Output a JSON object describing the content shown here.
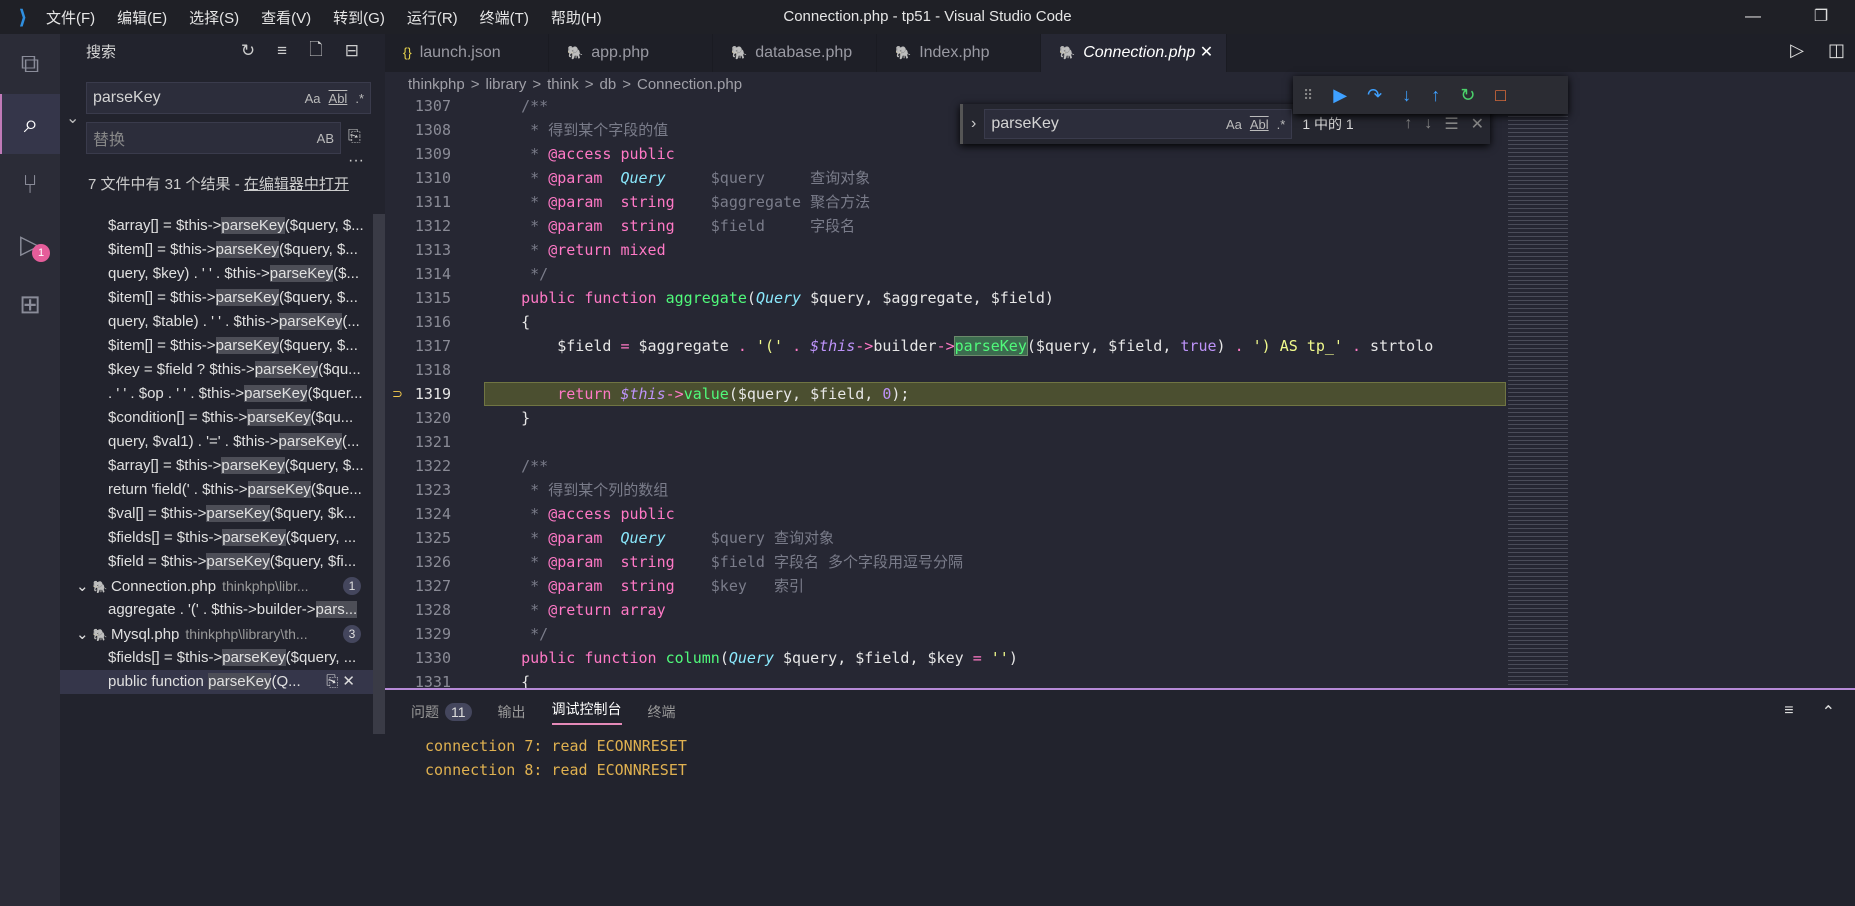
{
  "window": {
    "title": "Connection.php - tp51 - Visual Studio Code",
    "menu": [
      "文件(F)",
      "编辑(E)",
      "选择(S)",
      "查看(V)",
      "转到(G)",
      "运行(R)",
      "终端(T)",
      "帮助(H)"
    ]
  },
  "activity": {
    "debug_badge": "1"
  },
  "sidebar": {
    "title": "搜索",
    "search_value": "parseKey",
    "replace_placeholder": "替换",
    "opt_case": "Aa",
    "opt_word": "Abl",
    "opt_regex": ".*",
    "opt_preserve": "AB",
    "summary": "7 文件中有 31 个结果 - ",
    "open_in_editor": "在编辑器中打开",
    "results": [
      {
        "pre": "$array[] = $this->",
        "hl": "parseKey",
        "post": "($query, $..."
      },
      {
        "pre": "$item[] = $this->",
        "hl": "parseKey",
        "post": "($query, $..."
      },
      {
        "pre": "query, $key) . ' ' . $this->",
        "hl": "parseKey",
        "post": "($..."
      },
      {
        "pre": "$item[] = $this->",
        "hl": "parseKey",
        "post": "($query, $..."
      },
      {
        "pre": "query, $table) . ' ' . $this->",
        "hl": "parseKey",
        "post": "(..."
      },
      {
        "pre": "$item[] = $this->",
        "hl": "parseKey",
        "post": "($query, $..."
      },
      {
        "pre": "$key = $field ? $this->",
        "hl": "parseKey",
        "post": "($qu..."
      },
      {
        "pre": ". ' ' . $op . ' ' . $this->",
        "hl": "parseKey",
        "post": "($quer..."
      },
      {
        "pre": "$condition[] = $this->",
        "hl": "parseKey",
        "post": "($qu..."
      },
      {
        "pre": "query, $val1) . '=' . $this->",
        "hl": "parseKey",
        "post": "(..."
      },
      {
        "pre": "$array[] = $this->",
        "hl": "parseKey",
        "post": "($query, $..."
      },
      {
        "pre": "return 'field(' . $this->",
        "hl": "parseKey",
        "post": "($que..."
      },
      {
        "pre": "$val[] = $this->",
        "hl": "parseKey",
        "post": "($query, $k..."
      },
      {
        "pre": "$fields[] = $this->",
        "hl": "parseKey",
        "post": "($query, ..."
      },
      {
        "pre": "$field = $this->",
        "hl": "parseKey",
        "post": "($query, $fi..."
      },
      {
        "file": "Connection.php",
        "path": "thinkphp\\libr...",
        "count": "1"
      },
      {
        "pre": "aggregate . '(' . $this->builder->",
        "hl": "pars...",
        "post": ""
      },
      {
        "file": "Mysql.php",
        "path": "thinkphp\\library\\th...",
        "count": "3"
      },
      {
        "pre": "$fields[] = $this->",
        "hl": "parseKey",
        "post": "($query, ..."
      },
      {
        "pre": "public function ",
        "hl": "parseKey",
        "post": "(Q...",
        "selected": true
      }
    ]
  },
  "tabs": [
    {
      "label": "launch.json",
      "icon": "{}"
    },
    {
      "label": "app.php",
      "icon": "php"
    },
    {
      "label": "database.php",
      "icon": "php"
    },
    {
      "label": "Index.php",
      "icon": "php"
    },
    {
      "label": "Connection.php",
      "icon": "php",
      "active": true
    }
  ],
  "breadcrumb": [
    "thinkphp",
    ">",
    "library",
    ">",
    "think",
    ">",
    "db",
    ">",
    "Connection.php"
  ],
  "find": {
    "value": "parseKey",
    "opt_case": "Aa",
    "opt_word": "Abl",
    "opt_regex": ".*",
    "count": "1 中的 1"
  },
  "code": {
    "first_line": 1307,
    "current_line": 1319,
    "lines": [
      [
        [
          "    /**",
          "c"
        ]
      ],
      [
        [
          "     * 得到某个字段的值",
          "c"
        ]
      ],
      [
        [
          "     * ",
          "c"
        ],
        [
          "@access",
          "cd"
        ],
        [
          " public",
          "cp"
        ]
      ],
      [
        [
          "     * ",
          "c"
        ],
        [
          "@param",
          "cd"
        ],
        [
          "  ",
          "c"
        ],
        [
          "Query",
          "ty"
        ],
        [
          "     $query     查询对象",
          "c"
        ]
      ],
      [
        [
          "     * ",
          "c"
        ],
        [
          "@param",
          "cd"
        ],
        [
          "  string",
          "cp"
        ],
        [
          "    $aggregate 聚合方法",
          "c"
        ]
      ],
      [
        [
          "     * ",
          "c"
        ],
        [
          "@param",
          "cd"
        ],
        [
          "  string",
          "cp"
        ],
        [
          "    $field     字段名",
          "c"
        ]
      ],
      [
        [
          "     * ",
          "c"
        ],
        [
          "@return",
          "cd"
        ],
        [
          " mixed",
          "cp"
        ]
      ],
      [
        [
          "     */",
          "c"
        ]
      ],
      [
        [
          "    ",
          "m"
        ],
        [
          "public function",
          "k"
        ],
        [
          " ",
          "m"
        ],
        [
          "aggregate",
          "fn"
        ],
        [
          "(",
          "m"
        ],
        [
          "Query",
          "ty"
        ],
        [
          " $query, $aggregate, $field)",
          "m"
        ]
      ],
      [
        [
          "    {",
          "m"
        ]
      ],
      [
        [
          "        $field ",
          "m"
        ],
        [
          "=",
          "op"
        ],
        [
          " $aggregate ",
          "m"
        ],
        [
          ".",
          "op"
        ],
        [
          " ",
          "m"
        ],
        [
          "'('",
          "s"
        ],
        [
          " ",
          "m"
        ],
        [
          ".",
          "op"
        ],
        [
          " ",
          "m"
        ],
        [
          "$this",
          "th"
        ],
        [
          "->",
          "op"
        ],
        [
          "builder",
          "m"
        ],
        [
          "->",
          "op"
        ],
        [
          "parseKey",
          "match"
        ],
        [
          "($query, $field, ",
          "m"
        ],
        [
          "true",
          "n"
        ],
        [
          ") ",
          "m"
        ],
        [
          ".",
          "op"
        ],
        [
          " ",
          "m"
        ],
        [
          "') AS tp_'",
          "s"
        ],
        [
          " ",
          "m"
        ],
        [
          ".",
          "op"
        ],
        [
          " strtolo",
          "m"
        ]
      ],
      [
        [
          "",
          "m"
        ]
      ],
      [
        [
          "        ",
          "m"
        ],
        [
          "return",
          "k"
        ],
        [
          " ",
          "m"
        ],
        [
          "$this",
          "th"
        ],
        [
          "->",
          "op"
        ],
        [
          "value",
          "fn"
        ],
        [
          "($query, $field, ",
          "m"
        ],
        [
          "0",
          "n"
        ],
        [
          ");",
          "m"
        ]
      ],
      [
        [
          "    }",
          "m"
        ]
      ],
      [
        [
          "",
          "m"
        ]
      ],
      [
        [
          "    /**",
          "c"
        ]
      ],
      [
        [
          "     * 得到某个列的数组",
          "c"
        ]
      ],
      [
        [
          "     * ",
          "c"
        ],
        [
          "@access",
          "cd"
        ],
        [
          " public",
          "cp"
        ]
      ],
      [
        [
          "     * ",
          "c"
        ],
        [
          "@param",
          "cd"
        ],
        [
          "  ",
          "c"
        ],
        [
          "Query",
          "ty"
        ],
        [
          "     $query 查询对象",
          "c"
        ]
      ],
      [
        [
          "     * ",
          "c"
        ],
        [
          "@param",
          "cd"
        ],
        [
          "  string",
          "cp"
        ],
        [
          "    $field 字段名 多个字段用逗号分隔",
          "c"
        ]
      ],
      [
        [
          "     * ",
          "c"
        ],
        [
          "@param",
          "cd"
        ],
        [
          "  string",
          "cp"
        ],
        [
          "    $key   索引",
          "c"
        ]
      ],
      [
        [
          "     * ",
          "c"
        ],
        [
          "@return",
          "cd"
        ],
        [
          " array",
          "cp"
        ]
      ],
      [
        [
          "     */",
          "c"
        ]
      ],
      [
        [
          "    ",
          "m"
        ],
        [
          "public function",
          "k"
        ],
        [
          " ",
          "m"
        ],
        [
          "column",
          "fn"
        ],
        [
          "(",
          "m"
        ],
        [
          "Query",
          "ty"
        ],
        [
          " $query, $field, $key ",
          "m"
        ],
        [
          "=",
          "op"
        ],
        [
          " ",
          "m"
        ],
        [
          "''",
          "s"
        ],
        [
          ")",
          "m"
        ]
      ],
      [
        [
          "    {",
          "m"
        ]
      ]
    ]
  },
  "panel": {
    "tabs": [
      {
        "label": "问题",
        "badge": "11"
      },
      {
        "label": "输出"
      },
      {
        "label": "调试控制台",
        "active": true
      },
      {
        "label": "终端"
      }
    ],
    "output": [
      "connection 7: read ECONNRESET",
      "connection 8: read ECONNRESET"
    ]
  }
}
